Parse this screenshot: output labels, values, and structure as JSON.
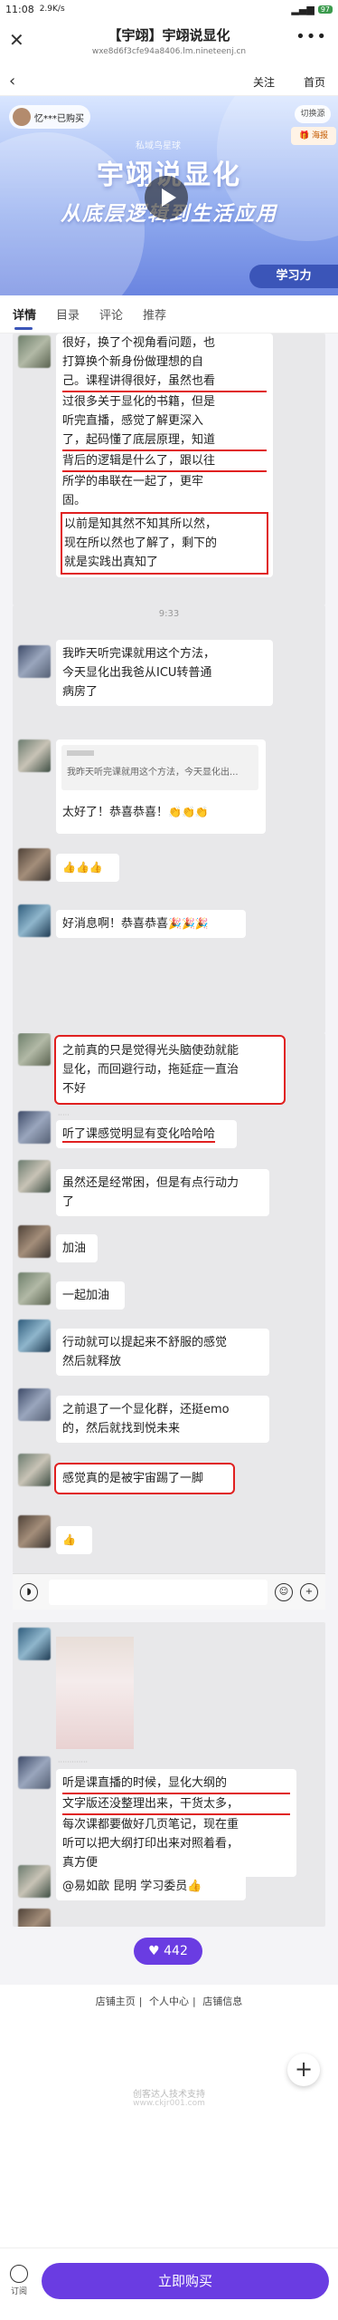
{
  "status": {
    "time": "11:08",
    "speed": "2.9K/s",
    "battery": "97"
  },
  "wechat": {
    "title": "【宇翊】宇翊说显化",
    "url": "wxe8d6f3cfe94a8406.lm.nineteenj.cn"
  },
  "nav": {
    "follow": "关注",
    "home": "首页"
  },
  "banner": {
    "user": "忆***已购买",
    "switch": "切换源",
    "poster": "海报",
    "brand": "私域鸟星球",
    "title": "宇翊说显化",
    "subtitle": "从底层逻辑到生活应用",
    "badge": "学习力"
  },
  "tabs": [
    "详情",
    "目录",
    "评论",
    "推荐"
  ],
  "chat1": {
    "lines": [
      "很好，换了个视角看问题，也",
      "打算换个新身份做理想的自",
      "己。课程讲得很好，虽然也看",
      "过很多关于显化的书籍，但是",
      "听完直播，感觉了解更深入",
      "了，起码懂了底层原理，知道",
      "背后的逻辑是什么了，跟以往",
      "所学的串联在一起了，更牢",
      "固。"
    ],
    "box": [
      "以前是知其然不知其所以然，",
      "现在所以然也了解了，剩下的",
      "就是实践出真知了"
    ]
  },
  "chat2": {
    "time": "9:33",
    "m1": [
      "我昨天听完课就用这个方法，",
      "今天显化出我爸从ICU转普通",
      "病房了"
    ],
    "quote": "我昨天听完课就用这个方法，今天显化出...",
    "m2": "太好了！恭喜恭喜！",
    "m2_emoji": "👏👏👏",
    "m3": "👍👍👍",
    "m4": "好消息啊！恭喜恭喜",
    "m4_emoji": "🎉🎉🎉"
  },
  "chat3": {
    "m1": [
      "之前真的只是觉得光头脑使劲就能",
      "显化，而回避行动，拖延症一直治",
      "不好"
    ],
    "m2": "听了课感觉明显有变化哈哈哈",
    "m3": [
      "虽然还是经常困，但是有点行动力",
      "了"
    ],
    "m4": "加油",
    "m5": "一起加油",
    "m6": [
      "行动就可以提起来不舒服的感觉",
      "然后就释放"
    ],
    "m7a": "之前退了一个显化群，还挺emo",
    "m7b": "的，然后就找到悦未来",
    "m8": "感觉真的是被宇宙踢了一脚",
    "m9": "👍"
  },
  "chat4": {
    "m1": [
      "听是课直播的时候，显化大纲的",
      "文字版还没整理出来，干货太多，",
      "每次课都要做好几页笔记，现在重",
      "听可以把大纲打印出来对照着看，",
      "真方便"
    ],
    "m2": "@易如歆 昆明  学习委员👍",
    "m3": "👍"
  },
  "likes": "442",
  "footer": {
    "links": [
      "店铺主页",
      "个人中心",
      "店铺信息"
    ],
    "tech": "创客达人技术支持",
    "tech2": "www.ckjr001.com"
  },
  "bottom": {
    "sub": "订阅",
    "buy": "立即购买"
  }
}
